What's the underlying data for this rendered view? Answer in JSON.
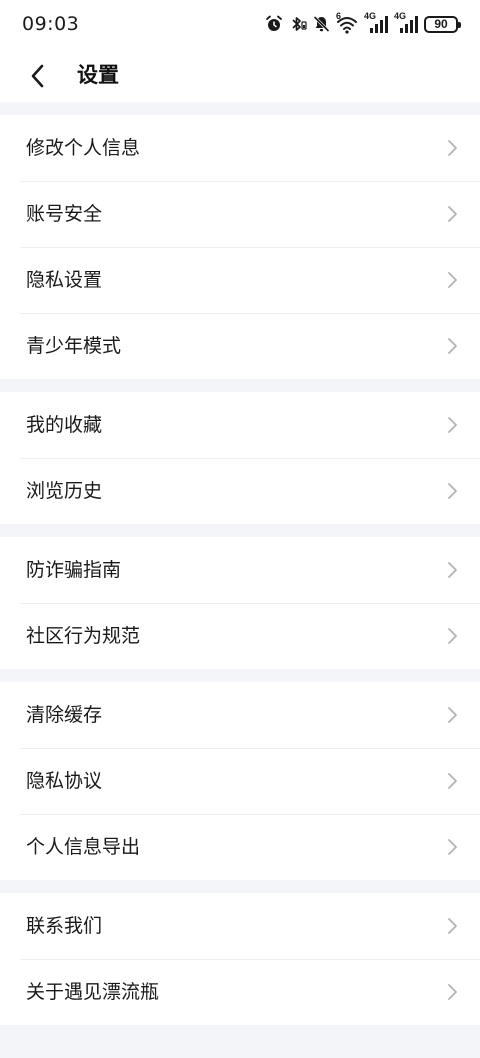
{
  "status_bar": {
    "time": "09:03",
    "signal1_label": "4G",
    "signal2_label": "4G",
    "wifi_label": "6",
    "battery": "90",
    "icons": [
      "alarm-icon",
      "bluetooth-icon",
      "mute-icon",
      "wifi-icon",
      "signal-icon",
      "signal-icon",
      "battery-icon"
    ]
  },
  "header": {
    "title": "设置",
    "back_icon": "chevron-left-icon"
  },
  "groups": [
    {
      "items": [
        "修改个人信息",
        "账号安全",
        "隐私设置",
        "青少年模式"
      ]
    },
    {
      "items": [
        "我的收藏",
        "浏览历史"
      ]
    },
    {
      "items": [
        "防诈骗指南",
        "社区行为规范"
      ]
    },
    {
      "items": [
        "清除缓存",
        "隐私协议",
        "个人信息导出"
      ]
    },
    {
      "items": [
        "联系我们",
        "关于遇见漂流瓶"
      ]
    }
  ],
  "colors": {
    "background": "#f4f5f9",
    "surface": "#ffffff",
    "text": "#1a1a1a",
    "chevron": "#b3b3b3"
  }
}
